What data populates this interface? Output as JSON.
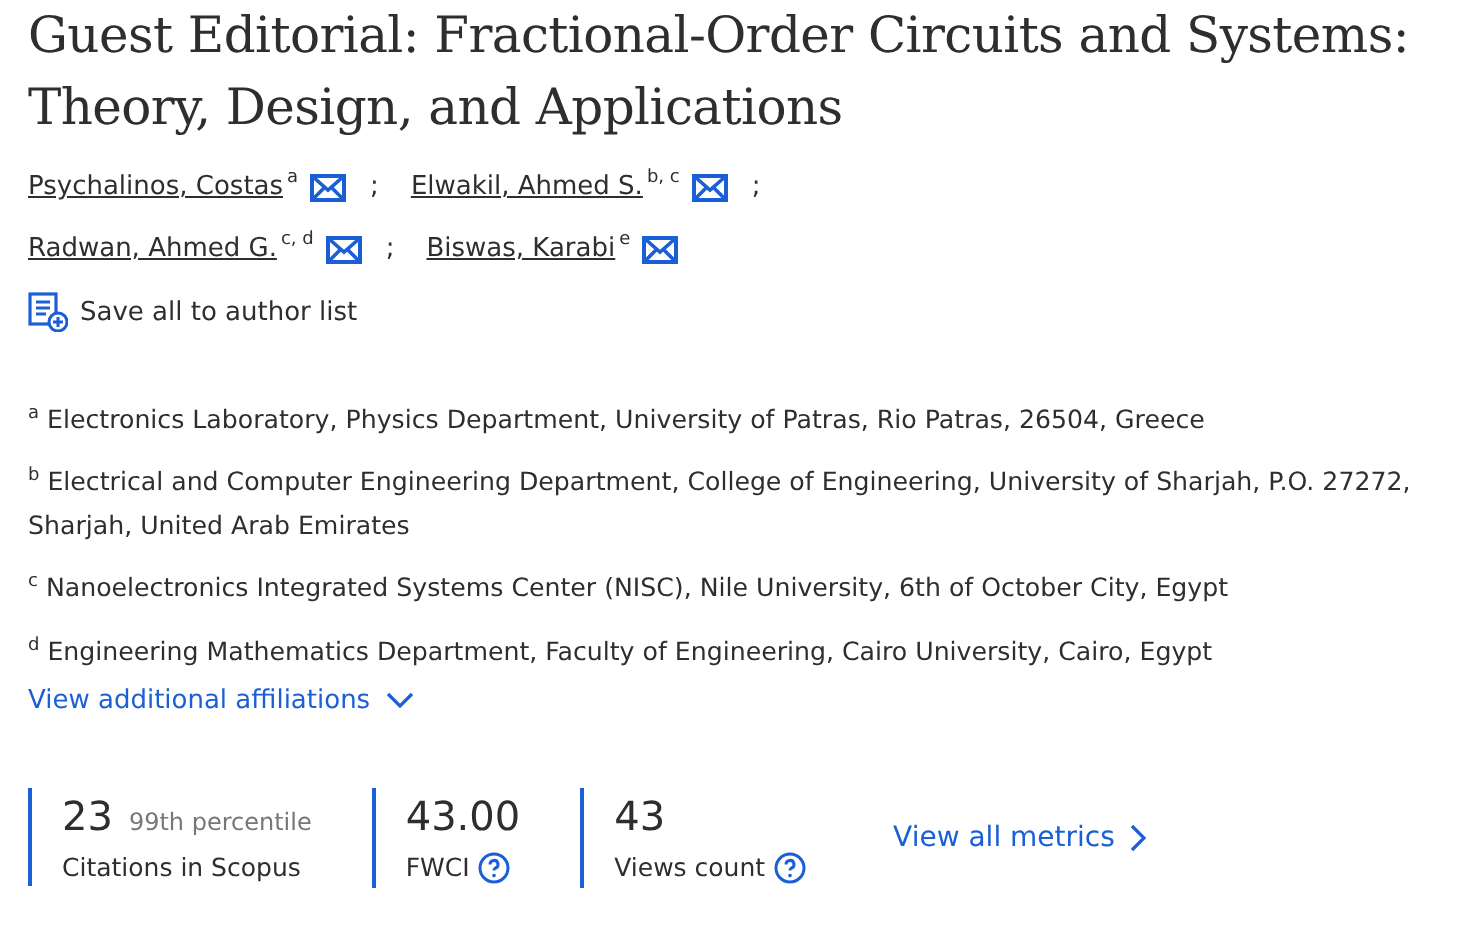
{
  "title": "Guest Editorial: Fractional-Order Circuits and Systems: Theory, Design, and Applications",
  "authors": [
    {
      "name": "Psychalinos, Costas",
      "sup": "a"
    },
    {
      "name": "Elwakil, Ahmed S.",
      "sup": "b, c"
    },
    {
      "name": "Radwan, Ahmed G.",
      "sup": "c, d"
    },
    {
      "name": "Biswas, Karabi",
      "sup": "e"
    }
  ],
  "separator": ";",
  "save_link": "Save all to author list",
  "affiliations": [
    {
      "sup": "a",
      "text": "Electronics Laboratory, Physics Department, University of Patras, Rio Patras, 26504, Greece"
    },
    {
      "sup": "b",
      "text": "Electrical and Computer Engineering Department, College of Engineering, University of Sharjah, P.O. 27272, Sharjah, United Arab Emirates"
    },
    {
      "sup": "c",
      "text": "Nanoelectronics Integrated Systems Center (NISC), Nile University, 6th of October City, Egypt"
    },
    {
      "sup": "d",
      "text": "Engineering Mathematics Department, Faculty of Engineering, Cairo University, Cairo, Egypt"
    }
  ],
  "more_affiliations": "View additional affiliations",
  "metrics": [
    {
      "value": "23",
      "note": "99th percentile",
      "label": "Citations in Scopus",
      "help": false
    },
    {
      "value": "43.00",
      "label": "FWCI",
      "help": true
    },
    {
      "value": "43",
      "label": "Views count",
      "help": true
    }
  ],
  "metrics_link": "View all metrics"
}
